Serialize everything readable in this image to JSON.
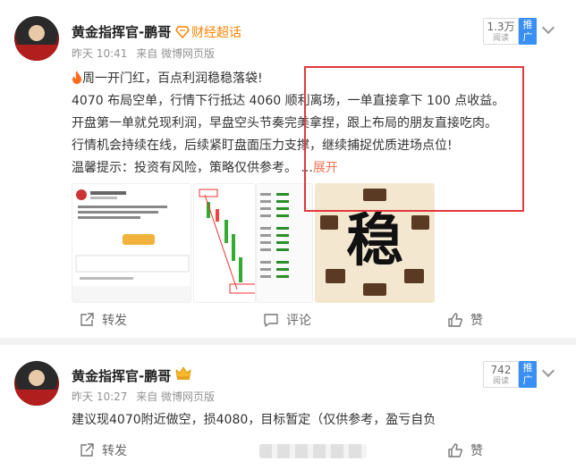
{
  "colors": {
    "accent": "#ff8200",
    "link": "#eb7350",
    "highlight_box": "#e0393e",
    "promote": "#3a8ff5"
  },
  "post1": {
    "author": "黄金指挥官-鹏哥",
    "verify_icon": "diamond-verified-icon",
    "verify_label": "财经超话",
    "time": "昨天 10:41",
    "source": "来自 微博网页版",
    "views": "1.3万",
    "views_label": "阅读",
    "promote_label": "推广",
    "lines": [
      "周一开门红，百点利润稳稳落袋!",
      "4070 布局空单，行情下行抵达 4060 顺利离场，一单直接拿下 100 点收益。",
      "开盘第一单就兑现利润，早盘空头节奏完美拿捏，跟上布局的朋友直接吃肉。",
      "行情机会持续在线，后续紧盯盘面压力支撑，继续捕捉优质进场点位!",
      "温馨提示：投资有风险，策略仅供参考。 ..."
    ],
    "fire_icon": "fire-icon",
    "expand_label": "展开",
    "image4_char": "稳",
    "actions": {
      "forward": "转发",
      "comment": "评论",
      "like": "赞"
    }
  },
  "post2": {
    "author": "黄金指挥官-鹏哥",
    "verify_icon": "crown-icon",
    "time": "昨天 10:27",
    "source": "来自 微博网页版",
    "views": "742",
    "views_label": "阅读",
    "promote_label": "推广",
    "line": "建议现4070附近做空，损4080，目标暂定（仅供参考，盈亏自负",
    "actions": {
      "forward": "转发",
      "like": "赞"
    }
  }
}
